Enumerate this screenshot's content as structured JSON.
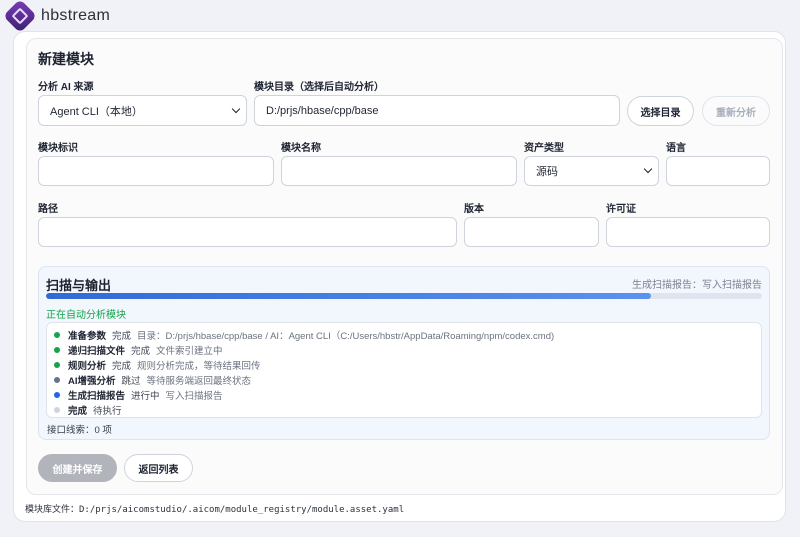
{
  "app": {
    "title": "hbstream",
    "logo_icon": "hbstream-logo-icon"
  },
  "form": {
    "title": "新建模块",
    "ai_source": {
      "label": "分析 AI 来源",
      "value": "Agent CLI（本地）"
    },
    "module_dir": {
      "label": "模块目录（选择后自动分析）",
      "value": "D:/prjs/hbase/cpp/base"
    },
    "choose_dir_label": "选择目录",
    "reanalyze_label": "重新分析",
    "module_id": {
      "label": "模块标识",
      "value": ""
    },
    "module_name": {
      "label": "模块名称",
      "value": ""
    },
    "asset_type": {
      "label": "资产类型",
      "value": "源码"
    },
    "language": {
      "label": "语言",
      "value": ""
    },
    "path": {
      "label": "路径",
      "value": ""
    },
    "version": {
      "label": "版本",
      "value": ""
    },
    "license": {
      "label": "许可证",
      "value": ""
    }
  },
  "scan": {
    "title": "扫描与输出",
    "status": "生成扫描报告：写入扫描报告",
    "progress": 0.845,
    "auto_status": "正在自动分析模块",
    "steps": [
      {
        "name": "准备参数",
        "state": "完成",
        "detail": "目录：D:/prjs/hbase/cpp/base / AI：Agent CLI（C:/Users/hbstr/AppData/Roaming/npm/codex.cmd)",
        "color": "#16a34a"
      },
      {
        "name": "递归扫描文件",
        "state": "完成",
        "detail": "文件索引建立中",
        "color": "#16a34a"
      },
      {
        "name": "规则分析",
        "state": "完成",
        "detail": "规则分析完成，等待结果回传",
        "color": "#16a34a"
      },
      {
        "name": "AI增强分析",
        "state": "跳过",
        "detail": "等待服务端返回最终状态",
        "color": "#64748b"
      },
      {
        "name": "生成扫描报告",
        "state": "进行中",
        "detail": "写入扫描报告",
        "color": "#2563eb"
      },
      {
        "name": "完成",
        "state": "待执行",
        "detail": "",
        "color": "#cbd5e1"
      }
    ],
    "hint": "接口线索：0 项"
  },
  "actions": {
    "create_label": "创建并保存",
    "back_label": "返回列表"
  },
  "footer": {
    "text": "模块库文件：D:/prjs/aicomstudio/.aicom/module_registry/module.asset.yaml"
  }
}
